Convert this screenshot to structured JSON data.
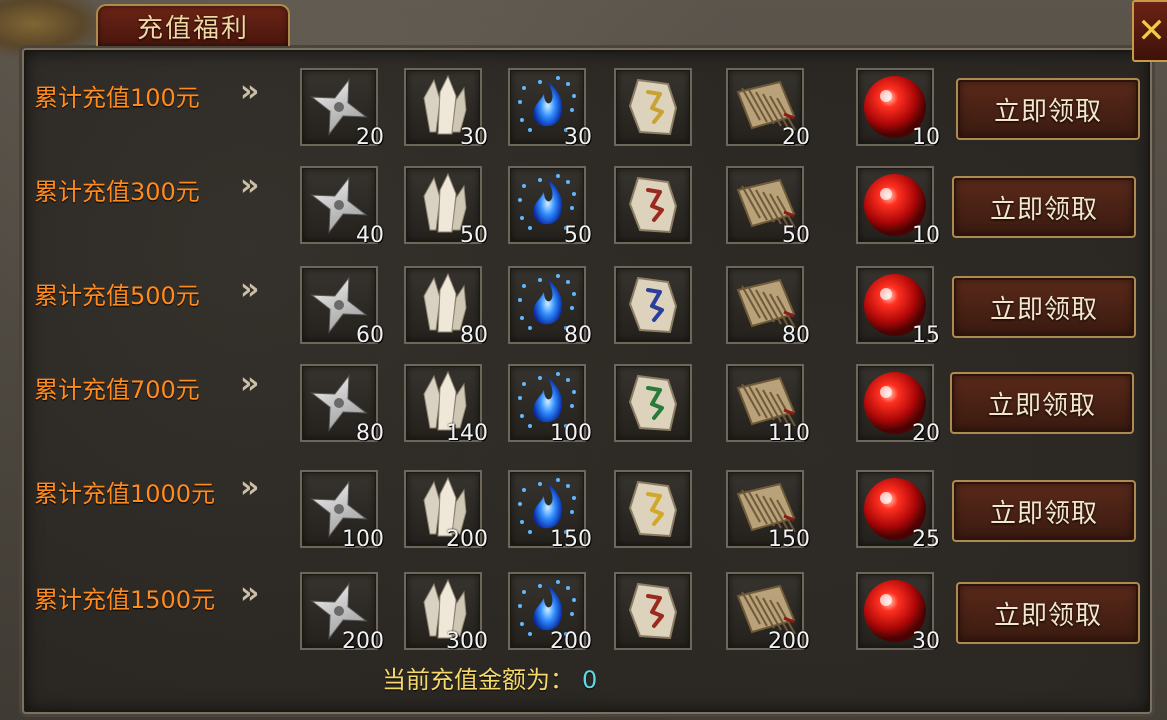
{
  "window": {
    "title": "充值福利",
    "close_label": "✕"
  },
  "colors": {
    "tier_label": "#ff8a1e",
    "footer_label": "#f6d86a",
    "footer_amount": "#5fd8e8"
  },
  "arrows_glyph": "»",
  "item_icons": [
    "shuriken-icon",
    "crystal-icon",
    "blue-flame-icon",
    "rune-stone-icon",
    "scroll-icon",
    "red-orb-icon"
  ],
  "tiers": [
    {
      "label": "累计充值100元",
      "counts": [
        "20",
        "30",
        "30",
        "",
        "20",
        "10"
      ],
      "rune_color": "#c9a236",
      "button": "立即领取"
    },
    {
      "label": "累计充值300元",
      "counts": [
        "40",
        "50",
        "50",
        "",
        "50",
        "10"
      ],
      "rune_color": "#9a2a1e",
      "button": "立即领取"
    },
    {
      "label": "累计充值500元",
      "counts": [
        "60",
        "80",
        "80",
        "",
        "80",
        "15"
      ],
      "rune_color": "#2a3e9a",
      "button": "立即领取"
    },
    {
      "label": "累计充值700元",
      "counts": [
        "80",
        "140",
        "100",
        "",
        "110",
        "20"
      ],
      "rune_color": "#2a7a3a",
      "button": "立即领取"
    },
    {
      "label": "累计充值1000元",
      "counts": [
        "100",
        "200",
        "150",
        "",
        "150",
        "25"
      ],
      "rune_color": "#d2a82a",
      "button": "立即领取"
    },
    {
      "label": "累计充值1500元",
      "counts": [
        "200",
        "300",
        "200",
        "",
        "200",
        "30"
      ],
      "rune_color": "#9a2a1e",
      "button": "立即领取"
    }
  ],
  "footer": {
    "label": "当前充值金额为：",
    "amount": "0"
  }
}
